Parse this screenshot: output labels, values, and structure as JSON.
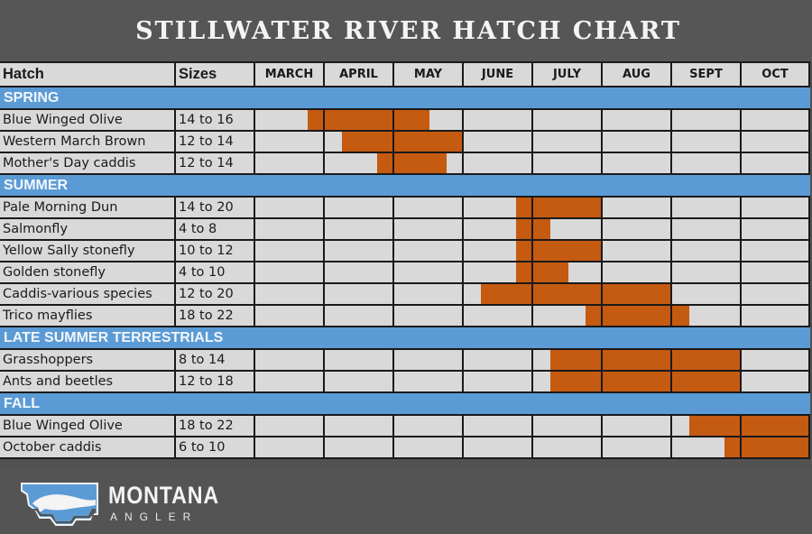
{
  "chart_data": {
    "type": "gantt",
    "title": "STILLWATER RIVER HATCH CHART",
    "columns": {
      "hatch": "Hatch",
      "sizes": "Sizes"
    },
    "months": [
      "MARCH",
      "APRIL",
      "MAY",
      "JUNE",
      "JULY",
      "AUG",
      "SEPT",
      "OCT"
    ],
    "range_unit": "months offset from start of MARCH (0 = Mar 1, 8 = end of Oct)",
    "colors": {
      "bar": "#c55a11",
      "section": "#5b9bd5",
      "cell": "#d9d9d9",
      "title_bg": "#565656"
    },
    "sections": [
      {
        "name": "SPRING",
        "items": [
          {
            "hatch": "Blue Winged Olive",
            "sizes": "14 to 16",
            "start": 0.75,
            "end": 2.5
          },
          {
            "hatch": "Western March Brown",
            "sizes": "12 to 14",
            "start": 1.25,
            "end": 3.0
          },
          {
            "hatch": "Mother's Day caddis",
            "sizes": "12 to 14",
            "start": 1.75,
            "end": 2.75
          }
        ]
      },
      {
        "name": "SUMMER",
        "items": [
          {
            "hatch": "Pale Morning Dun",
            "sizes": "14 to 20",
            "start": 3.75,
            "end": 5.0
          },
          {
            "hatch": "Salmonfly",
            "sizes": "4 to 8",
            "start": 3.75,
            "end": 4.25
          },
          {
            "hatch": "Yellow Sally stonefly",
            "sizes": "10 to 12",
            "start": 3.75,
            "end": 5.0
          },
          {
            "hatch": "Golden stonefly",
            "sizes": "4 to 10",
            "start": 3.75,
            "end": 4.5
          },
          {
            "hatch": "Caddis-various species",
            "sizes": "12 to 20",
            "start": 3.25,
            "end": 6.0
          },
          {
            "hatch": "Trico mayflies",
            "sizes": "18 to 22",
            "start": 4.75,
            "end": 6.25
          }
        ]
      },
      {
        "name": "LATE SUMMER TERRESTRIALS",
        "items": [
          {
            "hatch": "Grasshoppers",
            "sizes": "8 to 14",
            "start": 4.25,
            "end": 7.0
          },
          {
            "hatch": "Ants and beetles",
            "sizes": "12 to 18",
            "start": 4.25,
            "end": 7.0
          }
        ]
      },
      {
        "name": "FALL",
        "items": [
          {
            "hatch": "Blue Winged Olive",
            "sizes": "18 to 22",
            "start": 6.25,
            "end": 8.0
          },
          {
            "hatch": "October caddis",
            "sizes": "6 to 10",
            "start": 6.75,
            "end": 8.0
          }
        ]
      }
    ]
  },
  "footer": {
    "logo_icon": "montana-fish-logo-icon",
    "brand_name": "MONTANA",
    "brand_sub": "ANGLER"
  }
}
